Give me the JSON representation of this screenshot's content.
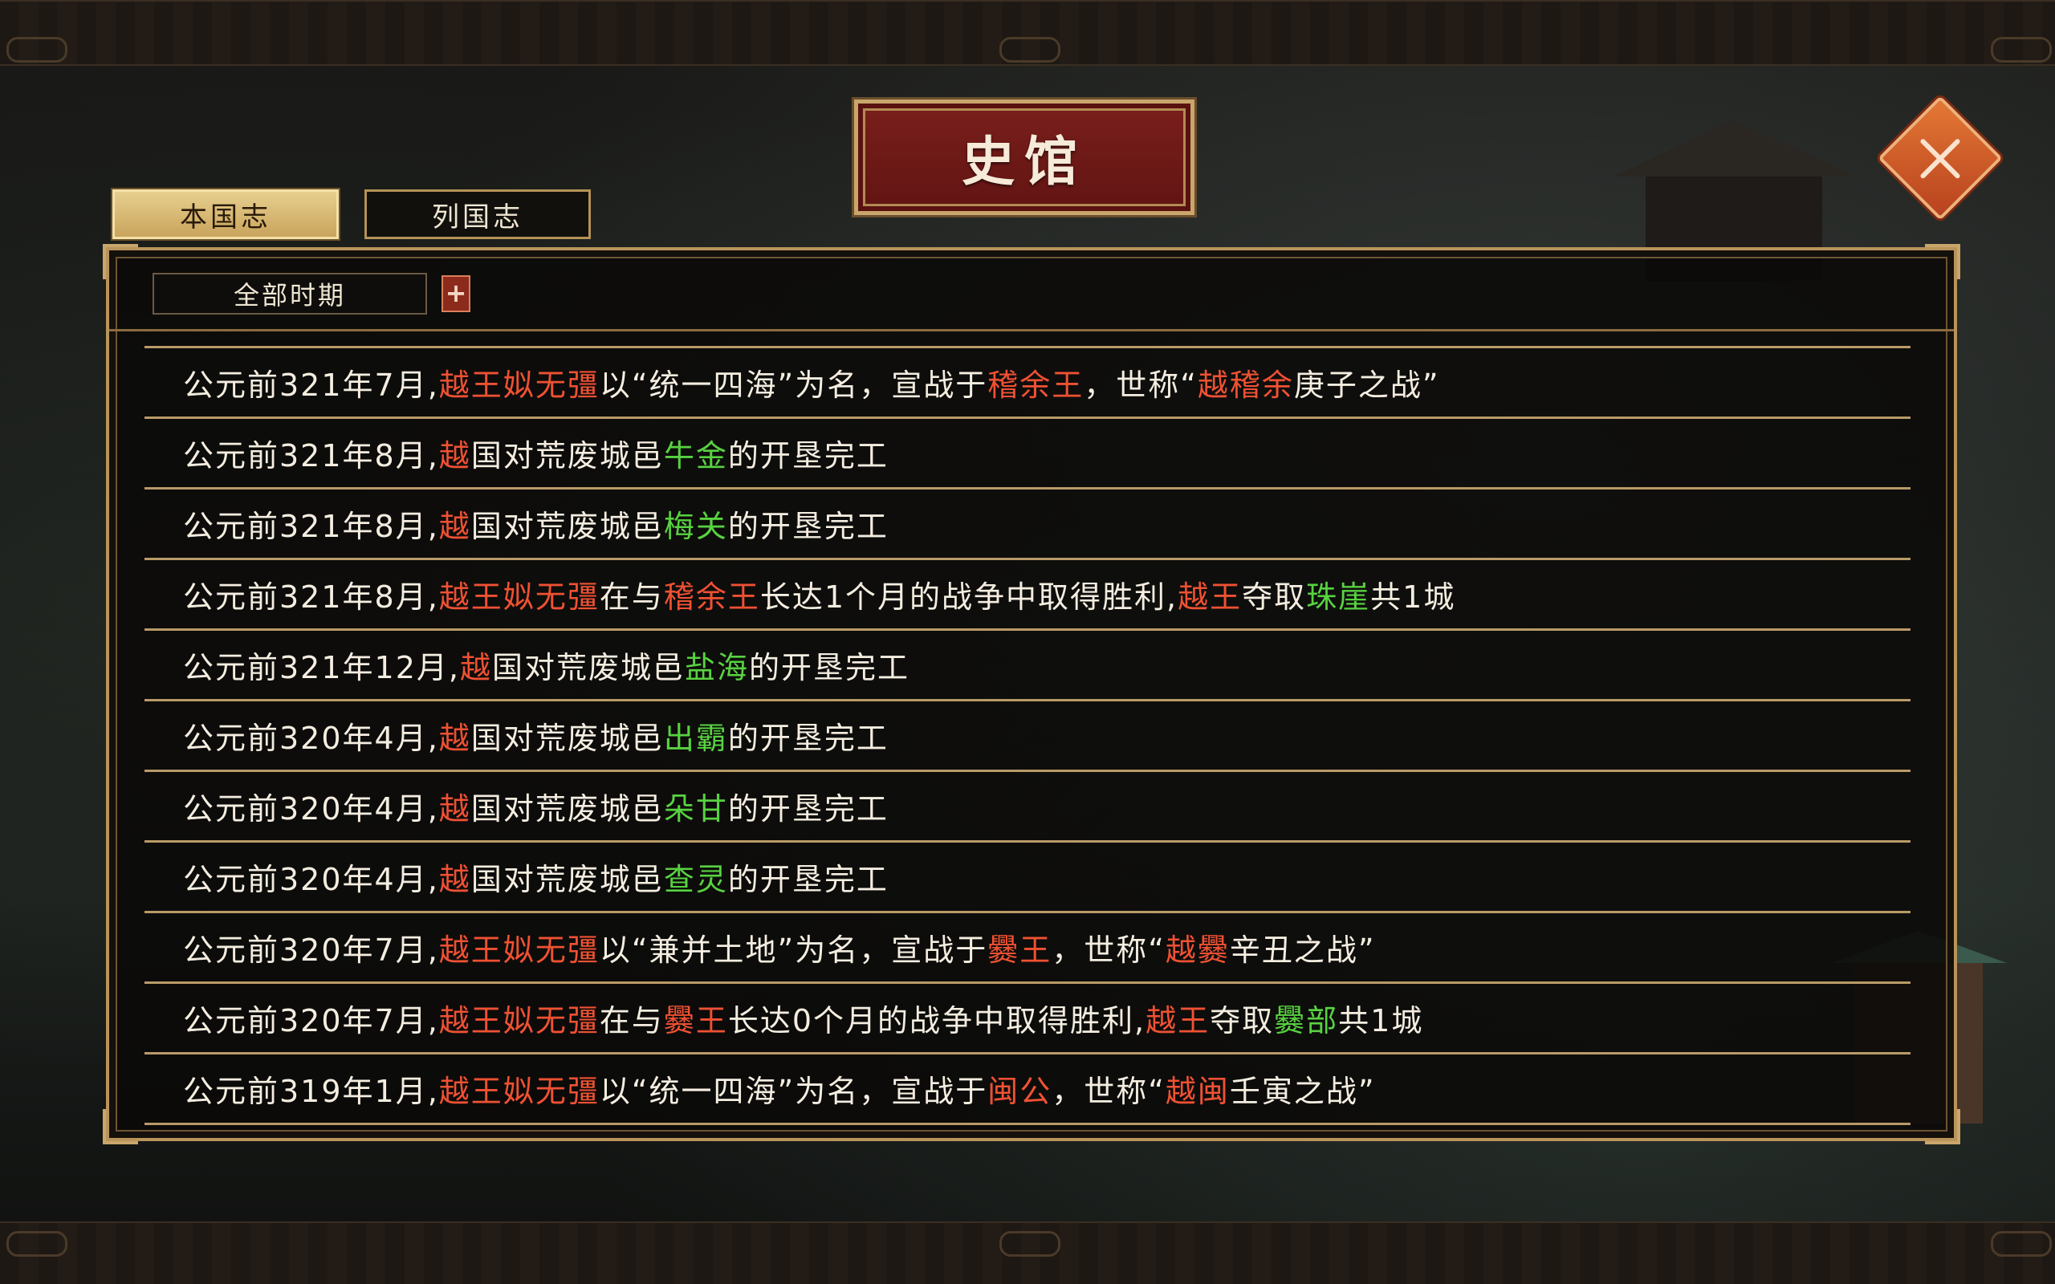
{
  "window": {
    "title": "史馆",
    "close_icon": "close-icon"
  },
  "tabs": [
    {
      "id": "home",
      "label": "本国志",
      "active": true
    },
    {
      "id": "states",
      "label": "列国志",
      "active": false
    }
  ],
  "filter": {
    "period_label": "全部时期",
    "add_label": "+"
  },
  "colors": {
    "text": "#f4ede0",
    "person_or_state": "#ef5133",
    "city": "#58d241",
    "accent_gold": "#b9945a",
    "title_plate": "#7a1f1c",
    "close_button": "#d9612a"
  },
  "records": [
    {
      "segments": [
        {
          "text": "公元前321年7月,",
          "t": "n"
        },
        {
          "text": "越王",
          "t": "r"
        },
        {
          "text": "姒无彊",
          "t": "p"
        },
        {
          "text": "以“统一四海”为名，宣战于",
          "t": "n"
        },
        {
          "text": "稽余王",
          "t": "r"
        },
        {
          "text": "，世称“",
          "t": "n"
        },
        {
          "text": "越稽余",
          "t": "r"
        },
        {
          "text": "庚子之战”",
          "t": "n"
        }
      ]
    },
    {
      "segments": [
        {
          "text": "公元前321年8月,",
          "t": "n"
        },
        {
          "text": "越",
          "t": "r"
        },
        {
          "text": "国对荒废城邑",
          "t": "n"
        },
        {
          "text": "牛金",
          "t": "c"
        },
        {
          "text": "的开垦完工",
          "t": "n"
        }
      ]
    },
    {
      "segments": [
        {
          "text": "公元前321年8月,",
          "t": "n"
        },
        {
          "text": "越",
          "t": "r"
        },
        {
          "text": "国对荒废城邑",
          "t": "n"
        },
        {
          "text": "梅关",
          "t": "c"
        },
        {
          "text": "的开垦完工",
          "t": "n"
        }
      ]
    },
    {
      "segments": [
        {
          "text": "公元前321年8月,",
          "t": "n"
        },
        {
          "text": "越王",
          "t": "r"
        },
        {
          "text": "姒无彊",
          "t": "p"
        },
        {
          "text": "在与",
          "t": "n"
        },
        {
          "text": "稽余王",
          "t": "r"
        },
        {
          "text": "长达1个月的战争中取得胜利,",
          "t": "n"
        },
        {
          "text": "越王",
          "t": "r"
        },
        {
          "text": "夺取",
          "t": "n"
        },
        {
          "text": "珠崖",
          "t": "c"
        },
        {
          "text": "共1城",
          "t": "n"
        }
      ]
    },
    {
      "segments": [
        {
          "text": "公元前321年12月,",
          "t": "n"
        },
        {
          "text": "越",
          "t": "r"
        },
        {
          "text": "国对荒废城邑",
          "t": "n"
        },
        {
          "text": "盐海",
          "t": "c"
        },
        {
          "text": "的开垦完工",
          "t": "n"
        }
      ]
    },
    {
      "segments": [
        {
          "text": "公元前320年4月,",
          "t": "n"
        },
        {
          "text": "越",
          "t": "r"
        },
        {
          "text": "国对荒废城邑",
          "t": "n"
        },
        {
          "text": "出霸",
          "t": "c"
        },
        {
          "text": "的开垦完工",
          "t": "n"
        }
      ]
    },
    {
      "segments": [
        {
          "text": "公元前320年4月,",
          "t": "n"
        },
        {
          "text": "越",
          "t": "r"
        },
        {
          "text": "国对荒废城邑",
          "t": "n"
        },
        {
          "text": "朵甘",
          "t": "c"
        },
        {
          "text": "的开垦完工",
          "t": "n"
        }
      ]
    },
    {
      "segments": [
        {
          "text": "公元前320年4月,",
          "t": "n"
        },
        {
          "text": "越",
          "t": "r"
        },
        {
          "text": "国对荒废城邑",
          "t": "n"
        },
        {
          "text": "查灵",
          "t": "c"
        },
        {
          "text": "的开垦完工",
          "t": "n"
        }
      ]
    },
    {
      "segments": [
        {
          "text": "公元前320年7月,",
          "t": "n"
        },
        {
          "text": "越王",
          "t": "r"
        },
        {
          "text": "姒无彊",
          "t": "p"
        },
        {
          "text": "以“兼并土地”为名，宣战于",
          "t": "n"
        },
        {
          "text": "爨王",
          "t": "r"
        },
        {
          "text": "，世称“",
          "t": "n"
        },
        {
          "text": "越爨",
          "t": "r"
        },
        {
          "text": "辛丑之战”",
          "t": "n"
        }
      ]
    },
    {
      "segments": [
        {
          "text": "公元前320年7月,",
          "t": "n"
        },
        {
          "text": "越王",
          "t": "r"
        },
        {
          "text": "姒无彊",
          "t": "p"
        },
        {
          "text": "在与",
          "t": "n"
        },
        {
          "text": "爨王",
          "t": "r"
        },
        {
          "text": "长达0个月的战争中取得胜利,",
          "t": "n"
        },
        {
          "text": "越王",
          "t": "r"
        },
        {
          "text": "夺取",
          "t": "n"
        },
        {
          "text": "爨部",
          "t": "c"
        },
        {
          "text": "共1城",
          "t": "n"
        }
      ]
    },
    {
      "segments": [
        {
          "text": "公元前319年1月,",
          "t": "n"
        },
        {
          "text": "越王",
          "t": "r"
        },
        {
          "text": "姒无彊",
          "t": "p"
        },
        {
          "text": "以“统一四海”为名，宣战于",
          "t": "n"
        },
        {
          "text": "闽公",
          "t": "r"
        },
        {
          "text": "，世称“",
          "t": "n"
        },
        {
          "text": "越闽",
          "t": "r"
        },
        {
          "text": "壬寅之战”",
          "t": "n"
        }
      ]
    }
  ]
}
